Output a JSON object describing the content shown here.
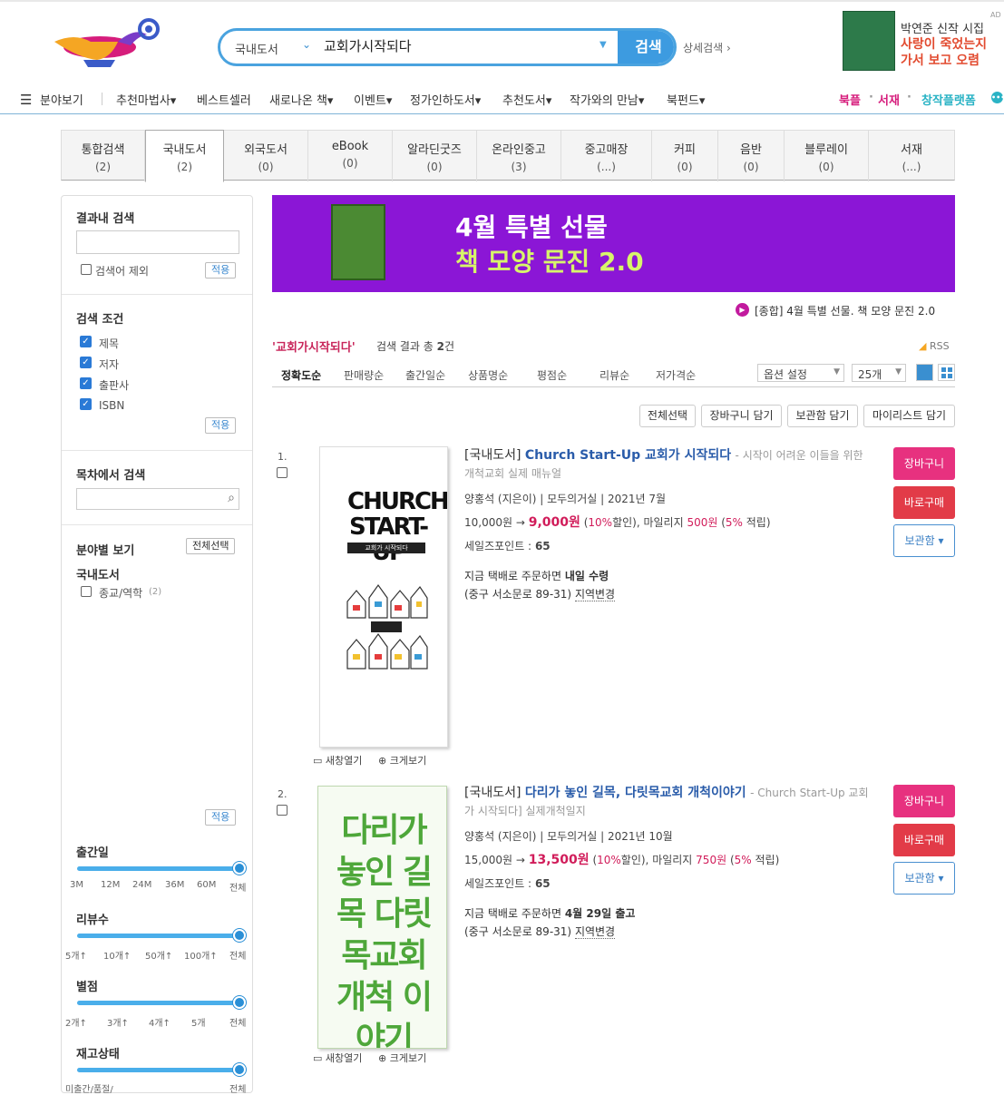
{
  "search": {
    "category": "국내도서",
    "query": "교회가시작되다",
    "button": "검색",
    "advanced": "상세검색 ›"
  },
  "ad": {
    "line1": "박연준 신작 시집",
    "line2": "사랑이 죽었는지",
    "line3": "가서 보고 오렴",
    "tag": "AD"
  },
  "nav": {
    "menu_label": "분야보기",
    "items": [
      "추천마법사▾",
      "베스트셀러",
      "새로나온 책▾",
      "이벤트▾",
      "정가인하도서▾",
      "추천도서▾",
      "작가와의 만남▾",
      "북펀드▾"
    ],
    "right": [
      "북플",
      "·",
      "서재",
      "·",
      "창작플랫폼"
    ]
  },
  "tabs": [
    {
      "label": "통합검색",
      "count": "(2)"
    },
    {
      "label": "국내도서",
      "count": "(2)"
    },
    {
      "label": "외국도서",
      "count": "(0)"
    },
    {
      "label": "eBook",
      "count": "(0)"
    },
    {
      "label": "알라딘굿즈",
      "count": "(0)"
    },
    {
      "label": "온라인중고",
      "count": "(3)"
    },
    {
      "label": "중고매장",
      "count": "(...)"
    },
    {
      "label": "커피",
      "count": "(0)"
    },
    {
      "label": "음반",
      "count": "(0)"
    },
    {
      "label": "블루레이",
      "count": "(0)"
    },
    {
      "label": "서재",
      "count": "(...)"
    }
  ],
  "sidebar": {
    "within_title": "결과내 검색",
    "exclude_label": "검색어 제외",
    "apply": "적용",
    "cond_title": "검색 조건",
    "conditions": [
      "제목",
      "저자",
      "출판사",
      "ISBN"
    ],
    "toc_title": "목차에서 검색",
    "field_title": "분야별 보기",
    "select_all": "전체선택",
    "field_group": "국내도서",
    "field_item": "종교/역학",
    "field_count": "(2)",
    "pubdate_title": "출간일",
    "pubdate_ticks": [
      "3M",
      "12M",
      "24M",
      "36M",
      "60M",
      "전체"
    ],
    "review_title": "리뷰수",
    "review_ticks": [
      "5개↑",
      "10개↑",
      "50개↑",
      "100개↑",
      "전체"
    ],
    "rating_title": "별점",
    "rating_ticks": [
      "2개↑",
      "3개↑",
      "4개↑",
      "5개",
      "전체"
    ],
    "stock_title": "재고상태",
    "stock_ticks": [
      "미출간/품절/",
      "전체"
    ]
  },
  "banner": {
    "line1": "4월 특별 선물",
    "line2": "책 모양 문진 2.0",
    "note": "[종합] 4월 특별 선물. 책 모양 문진 2.0"
  },
  "results": {
    "query_label": "'교회가시작되다'",
    "summary_prefix": "검색 결과 총",
    "summary_count": "2",
    "summary_suffix": "건",
    "rss": "RSS"
  },
  "sort": {
    "options": [
      "정확도순",
      "판매량순",
      "출간일순",
      "상품명순",
      "평점순",
      "리뷰순",
      "저가격순"
    ],
    "option_setting": "옵션 설정",
    "per_page": "25개"
  },
  "actions": [
    "전체선택",
    "장바구니 담기",
    "보관함 담기",
    "마이리스트 담기"
  ],
  "items": [
    {
      "num": "1.",
      "category": "[국내도서]",
      "title": "Church Start-Up 교회가 시작되다",
      "subtitle": "- 시작이 어려운 이들을 위한 개척교회 실제 매뉴얼",
      "meta": "양홍석 (지은이) | 모두의거실 | 2021년 7월",
      "list_price": "10,000원",
      "sale_price": "9,000원",
      "discount": "10%",
      "mileage": "500원",
      "mileage_rate": "5%",
      "salespoint_label": "세일즈포인트 :",
      "salespoint": "65",
      "delivery_prefix": "지금 택배로 주문하면",
      "delivery_when": "내일 수령",
      "address": "(중구 서소문로 89-31)",
      "change_region": "지역변경",
      "cover_title": "CHURCH START-UP",
      "cover_sub": "교회가 시작되다",
      "open_new": "새창열기",
      "zoom": "크게보기"
    },
    {
      "num": "2.",
      "category": "[국내도서]",
      "title": "다리가 놓인 길목, 다릿목교회 개척이야기",
      "subtitle": "- Church Start-Up 교회가 시작되다] 실제개척일지",
      "meta": "양홍석 (지은이) | 모두의거실 | 2021년 10월",
      "list_price": "15,000원",
      "sale_price": "13,500원",
      "discount": "10%",
      "mileage": "750원",
      "mileage_rate": "5%",
      "salespoint_label": "세일즈포인트 :",
      "salespoint": "65",
      "delivery_prefix": "지금 택배로 주문하면",
      "delivery_when": "4월 29일 출고",
      "address": "(중구 서소문로 89-31)",
      "change_region": "지역변경",
      "cover_title": "다리가 놓인 길목 다릿목교회 개척 이야기",
      "open_new": "새창열기",
      "zoom": "크게보기"
    }
  ],
  "buttons": {
    "cart": "장바구니",
    "buy": "바로구매",
    "keep": "보관함 ▾"
  },
  "colors": {
    "accent": "#3d9be0",
    "pink": "#e7317f",
    "red": "#e23b48",
    "banner": "#8b16d6",
    "price": "#d11c5a"
  }
}
